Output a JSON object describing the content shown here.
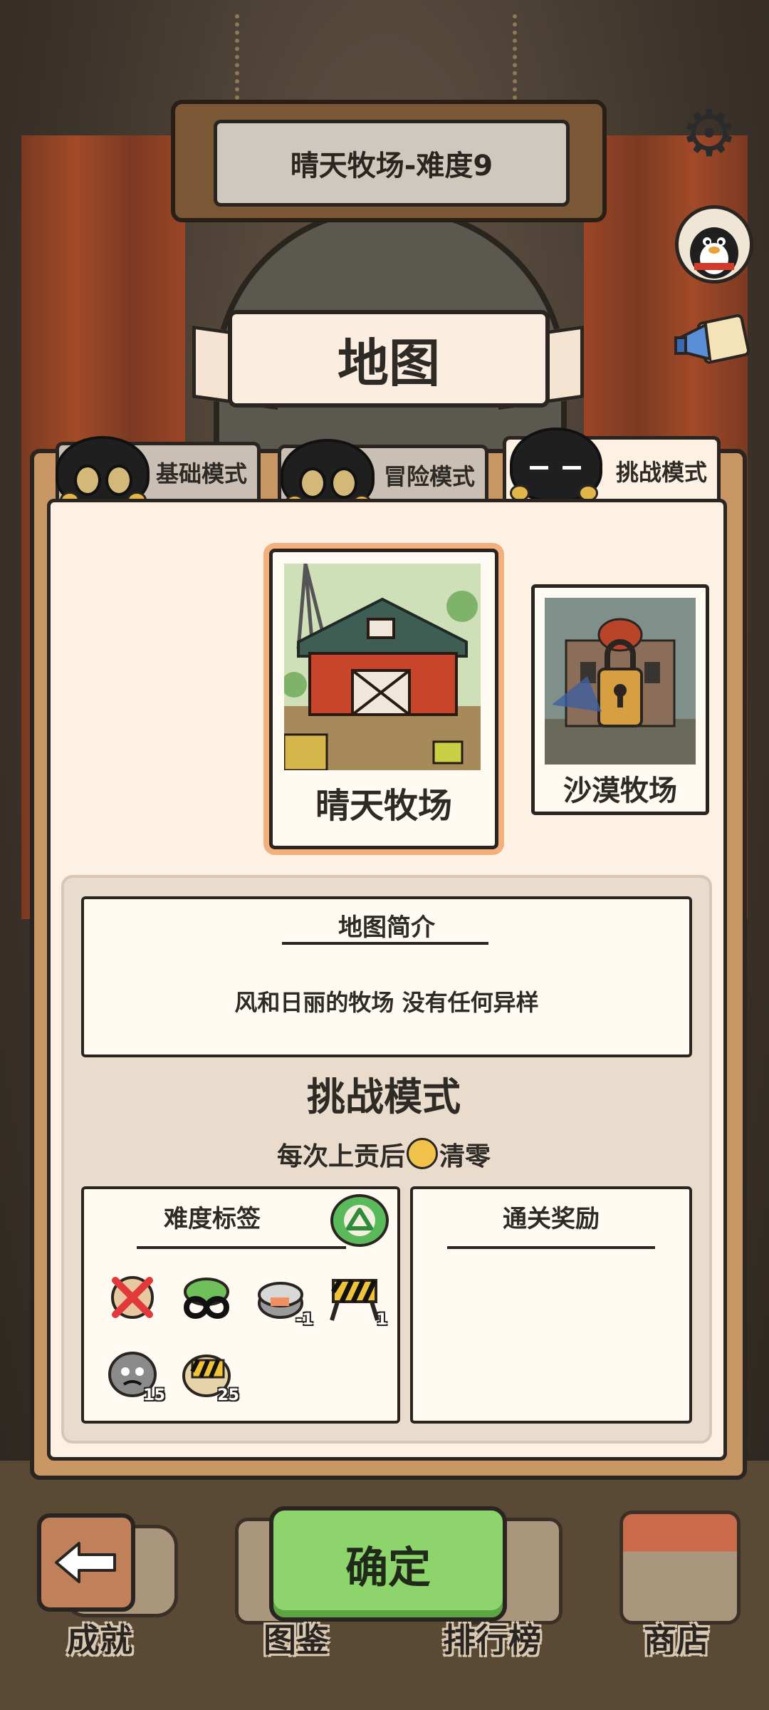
{
  "header": {
    "title": "晴天牧场-难度9"
  },
  "banner": {
    "title": "地图"
  },
  "tabs": [
    {
      "label": "基础模式",
      "active": false
    },
    {
      "label": "冒险模式",
      "active": false
    },
    {
      "label": "挑战模式",
      "active": true
    }
  ],
  "maps": [
    {
      "name": "晴天牧场",
      "selected": true,
      "locked": false
    },
    {
      "name": "沙漠牧场",
      "selected": false,
      "locked": true
    }
  ],
  "intro": {
    "title": "地图简介",
    "text": "风和日丽的牧场 没有任何异样"
  },
  "mode": {
    "title": "挑战模式",
    "subtitle_before": "每次上贡后",
    "subtitle_after": "清零"
  },
  "difficulty": {
    "title": "难度标签",
    "tags": [
      {
        "icon": "no-cross-icon",
        "value": ""
      },
      {
        "icon": "infinity-icon",
        "value": ""
      },
      {
        "icon": "can-icon",
        "value": "-1"
      },
      {
        "icon": "barrier-icon",
        "value": "1"
      },
      {
        "icon": "rock-face-icon",
        "value": "15"
      },
      {
        "icon": "barrier-bag-icon",
        "value": "25"
      }
    ]
  },
  "reward": {
    "title": "通关奖励"
  },
  "bottom_nav": [
    {
      "label": "成就"
    },
    {
      "label": "图鉴"
    },
    {
      "label": "排行榜"
    },
    {
      "label": "商店"
    }
  ],
  "buttons": {
    "confirm": "确定"
  },
  "colors": {
    "panel": "#c99766",
    "panel_inner": "#fdf1e4",
    "confirm": "#8dd46c",
    "selected_glow": "#f2b07c",
    "back_button": "#c0805a"
  }
}
